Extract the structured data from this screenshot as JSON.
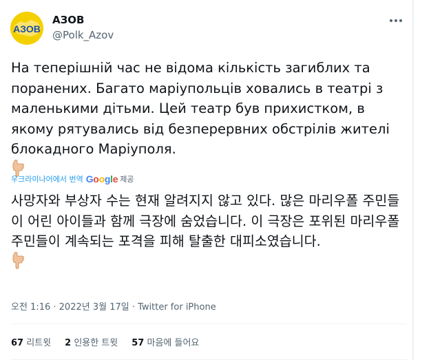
{
  "author": {
    "name": "АЗОВ",
    "handle": "@Polk_Azov",
    "avatar_text": "АЗОВ"
  },
  "menu_icon": "more-icon",
  "tweet": {
    "text": "На теперішній час не відома кількість загиблих та поранених. Багато маріупольців ховались в театрі з маленькими дітьми. Цей театр був прихистком, в якому рятувались від безперервних обстрілів жителі блокадного Маріуполя.",
    "emoji": "pointing-down-hand"
  },
  "translation": {
    "label": "우크라이나어에서 번역",
    "provider_letters": [
      "G",
      "o",
      "o",
      "g",
      "l",
      "e"
    ],
    "provider_colors": [
      "#4285F4",
      "#EA4335",
      "#FBBC05",
      "#4285F4",
      "#34A853",
      "#EA4335"
    ],
    "provided": "제공",
    "text": "사망자와 부상자 수는 현재 알려지지 않고 있다. 많은 마리우폴 주민들이 어린 아이들과 함께 극장에 숨었습니다. 이 극장은 포위된 마리우폴 주민들이 계속되는 포격을 피해 탈출한 대피소였습니다."
  },
  "meta": {
    "time": "오전 1:16",
    "sep1": " · ",
    "date": "2022년 3월 17일",
    "sep2": " · ",
    "source": "Twitter for iPhone"
  },
  "stats": [
    {
      "count": "67",
      "label": "리트윗"
    },
    {
      "count": "2",
      "label": "인용한 트윗"
    },
    {
      "count": "57",
      "label": "마음에 들어요"
    }
  ]
}
